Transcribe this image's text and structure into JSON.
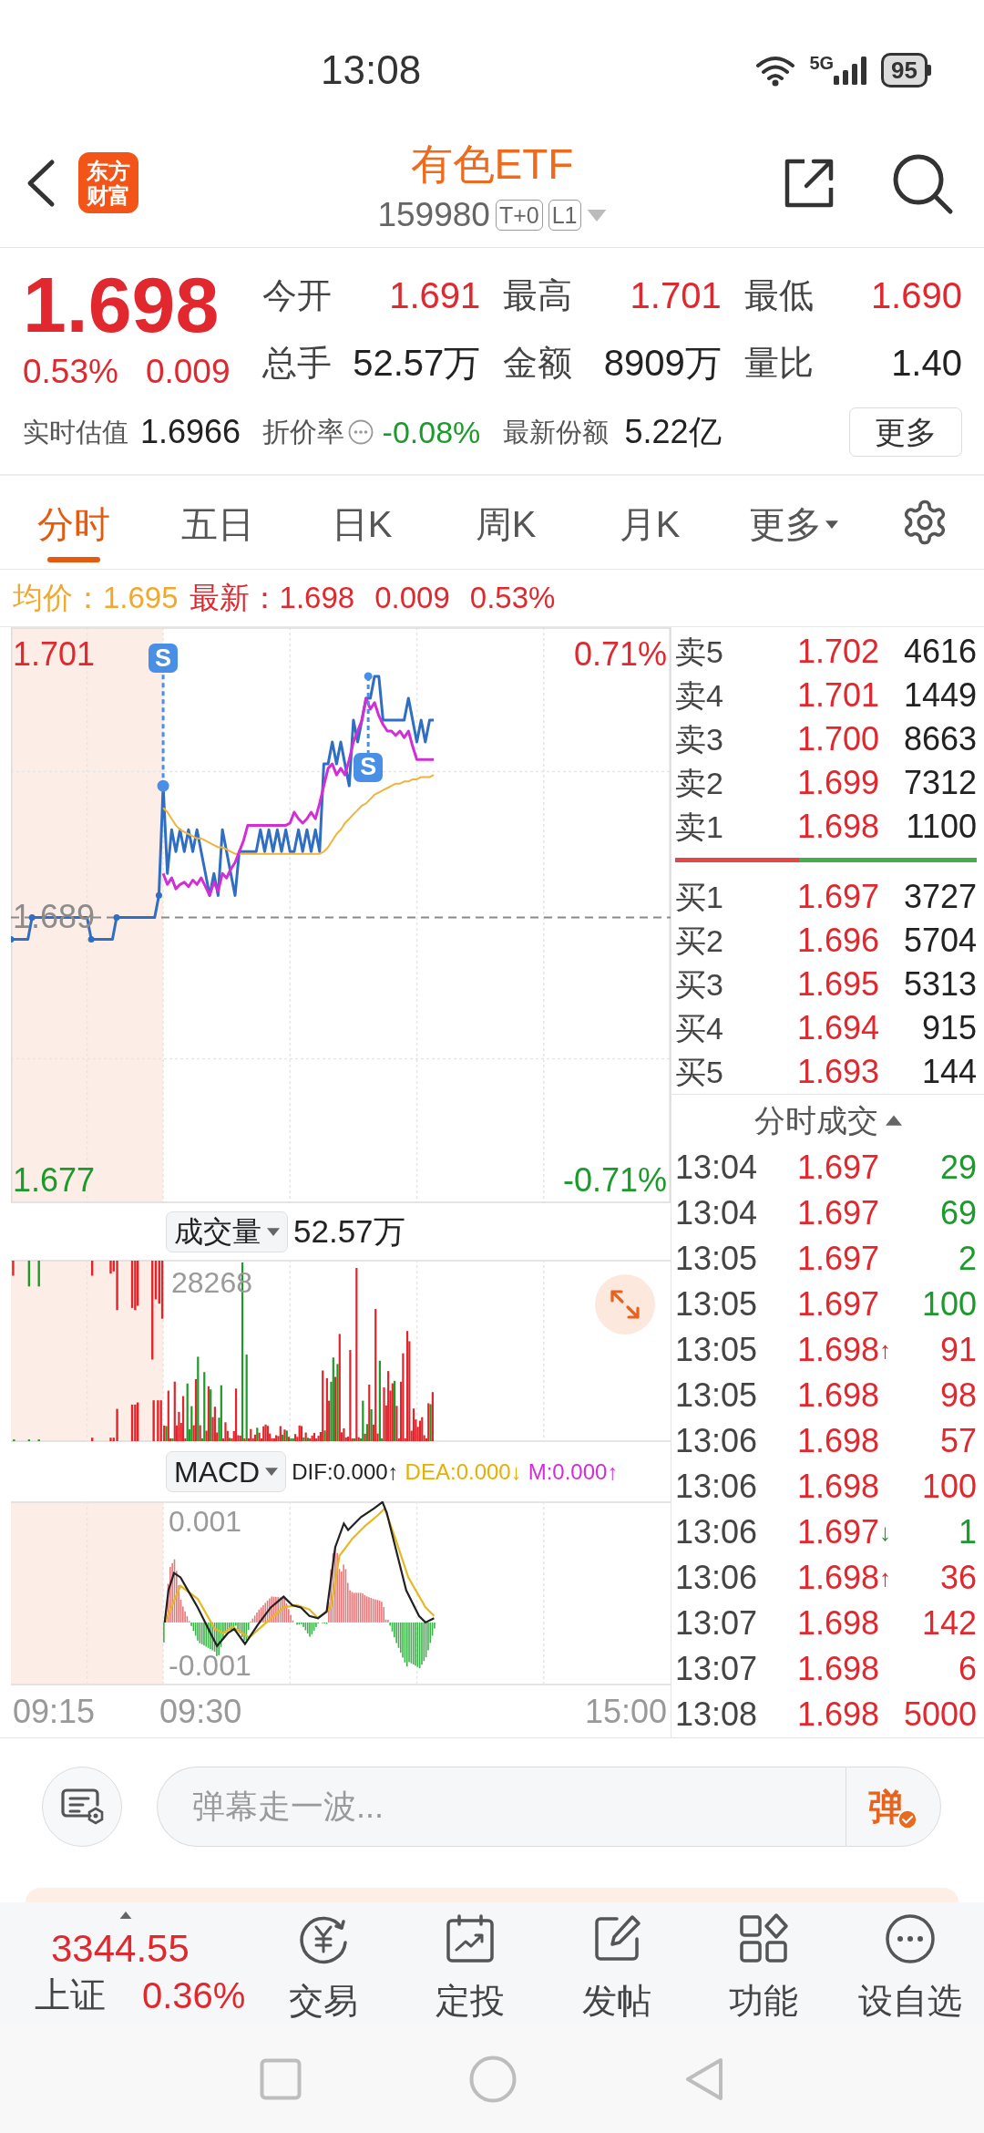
{
  "status_bar": {
    "time": "13:08",
    "network": "5G",
    "battery": "95"
  },
  "header": {
    "logo_lines": [
      "东方",
      "财富"
    ],
    "title": "有色ETF",
    "code": "159980",
    "tags": [
      "T+0",
      "L1"
    ]
  },
  "quote": {
    "price": "1.698",
    "change_percent": "0.53%",
    "change": "0.009",
    "stats": [
      {
        "label": "今开",
        "value": "1.691",
        "color": "#e1282f"
      },
      {
        "label": "最高",
        "value": "1.701",
        "color": "#e1282f"
      },
      {
        "label": "最低",
        "value": "1.690",
        "color": "#e1282f"
      },
      {
        "label": "总手",
        "value": "52.57万",
        "color": "#222222"
      },
      {
        "label": "金额",
        "value": "8909万",
        "color": "#222222"
      },
      {
        "label": "量比",
        "value": "1.40",
        "color": "#222222"
      }
    ],
    "estimate": {
      "label": "实时估值",
      "value": "1.6966"
    },
    "discount": {
      "label": "折价率",
      "value": "-0.08%"
    },
    "shares": {
      "label": "最新份额",
      "value": "5.22亿"
    },
    "more_button": "更多"
  },
  "tabs": [
    {
      "label": "分时",
      "selected": true,
      "kind": "tab"
    },
    {
      "label": "五日",
      "selected": false,
      "kind": "tab"
    },
    {
      "label": "日K",
      "selected": false,
      "kind": "tab"
    },
    {
      "label": "周K",
      "selected": false,
      "kind": "tab"
    },
    {
      "label": "月K",
      "selected": false,
      "kind": "tab"
    },
    {
      "label": "更多",
      "selected": false,
      "kind": "dropdown"
    }
  ],
  "legend": {
    "avg_label": "均价：",
    "avg_value": "1.695",
    "last_label": "最新：",
    "last_value": "1.698",
    "change": "0.009",
    "change_percent": "0.53%"
  },
  "price_chart": {
    "right_labels": [
      "0.71%",
      "-0.71%"
    ],
    "markers": [
      {
        "text": "S"
      },
      {
        "text": "S"
      }
    ],
    "chart_data": {
      "type": "line",
      "categories": [
        null,
        null,
        null,
        null,
        null,
        null,
        null,
        null,
        null,
        null,
        null,
        null,
        null,
        null,
        null,
        null,
        null,
        null,
        null,
        null,
        null,
        null,
        null,
        null,
        null,
        null,
        null,
        null,
        null,
        null,
        null,
        null,
        null,
        null,
        null,
        null,
        null,
        null,
        null,
        null,
        null,
        null,
        null,
        null,
        null,
        null,
        null,
        null,
        null,
        null,
        null,
        null,
        null,
        null,
        null,
        null,
        null,
        null,
        null,
        null,
        null,
        null,
        null,
        null,
        null,
        null,
        null,
        null,
        null,
        null,
        null,
        null,
        null,
        null,
        null,
        null,
        null,
        null,
        null,
        null,
        null,
        null,
        null,
        null,
        null,
        null,
        null,
        null,
        null,
        null,
        null,
        null,
        null,
        null,
        null,
        null,
        null,
        null,
        null,
        null,
        null,
        null,
        null,
        null,
        null,
        null,
        null,
        null,
        null,
        null,
        null,
        null,
        null,
        null,
        null,
        null,
        null,
        null,
        null,
        null,
        null,
        null,
        null,
        null,
        null,
        null,
        null,
        null,
        null,
        null,
        null,
        null,
        null,
        null,
        null,
        null,
        null,
        null,
        null,
        null,
        null,
        null,
        null,
        null,
        null,
        null,
        null,
        null,
        null,
        null,
        null,
        null,
        null,
        null,
        null,
        null,
        null
      ],
      "series": [
        {
          "color": "#2f6ec2",
          "values": [
            1.688,
            1.688,
            1.688,
            1.688,
            1.688,
            1.689,
            1.689,
            1.689,
            1.689,
            1.689,
            1.689,
            1.689,
            1.689,
            1.689,
            1.689,
            1.689,
            1.689,
            1.689,
            1.689,
            1.688,
            1.688,
            1.688,
            1.688,
            1.688,
            1.688,
            1.689,
            1.689,
            1.689,
            1.689,
            1.689,
            1.689,
            1.689,
            1.689,
            1.689,
            1.689,
            1.69,
            1.695,
            1.691,
            1.693,
            1.692,
            1.693,
            1.692,
            1.693,
            1.692,
            1.693,
            1.692,
            1.691,
            1.69,
            1.691,
            1.69,
            1.693,
            1.692,
            1.691,
            1.69,
            1.692,
            1.692,
            1.692,
            1.692,
            1.692,
            1.693,
            1.692,
            1.693,
            1.692,
            1.693,
            1.692,
            1.693,
            1.692,
            1.692,
            1.693,
            1.692,
            1.693,
            1.692,
            1.693,
            1.692,
            1.696,
            1.696,
            1.697,
            1.696,
            1.697,
            1.696,
            1.695,
            1.698,
            1.697,
            1.698,
            1.699,
            1.699,
            1.7,
            1.7,
            1.698,
            1.698,
            1.698,
            1.698,
            1.698,
            1.698,
            1.699,
            1.698,
            1.697,
            1.698,
            1.697,
            1.698,
            1.698,
            null,
            null,
            null,
            null,
            null,
            null,
            null,
            null,
            null,
            null,
            null,
            null,
            null,
            null,
            null,
            null,
            null,
            null,
            null,
            null,
            null,
            null,
            null,
            null,
            null,
            null,
            null,
            null,
            null,
            null,
            null,
            null,
            null,
            null,
            null,
            null,
            null,
            null,
            null,
            null,
            null,
            null,
            null,
            null,
            null,
            null,
            null,
            null,
            null,
            null,
            null,
            null,
            null,
            null,
            null,
            null
          ]
        },
        {
          "color": "#f0b43c",
          "values": [
            null,
            null,
            null,
            null,
            null,
            null,
            null,
            null,
            null,
            null,
            null,
            null,
            null,
            null,
            null,
            null,
            null,
            null,
            null,
            null,
            null,
            null,
            null,
            null,
            null,
            null,
            null,
            null,
            null,
            null,
            null,
            null,
            null,
            null,
            null,
            null,
            1.694,
            1.6938,
            1.6935,
            1.6932,
            1.693,
            1.6929,
            1.6928,
            1.6927,
            1.6926,
            1.6926,
            1.6925,
            1.6924,
            1.6923,
            1.6922,
            1.6922,
            1.6921,
            1.692,
            1.6919,
            1.6919,
            1.6919,
            1.6919,
            1.6919,
            1.6919,
            1.6919,
            1.6919,
            1.6919,
            1.6919,
            1.6919,
            1.6919,
            1.6919,
            1.6919,
            1.6919,
            1.6919,
            1.6919,
            1.6919,
            1.6919,
            1.6919,
            1.6919,
            1.692,
            1.6922,
            1.6925,
            1.6928,
            1.693,
            1.6933,
            1.6935,
            1.6937,
            1.6939,
            1.6941,
            1.6942,
            1.6944,
            1.6946,
            1.6947,
            1.6948,
            1.6949,
            1.695,
            1.6951,
            1.6951,
            1.6952,
            1.6952,
            1.6953,
            1.6953,
            1.6954,
            1.6954,
            1.6954,
            1.6955,
            null,
            null,
            null,
            null,
            null,
            null,
            null,
            null,
            null,
            null,
            null,
            null,
            null,
            null,
            null,
            null,
            null,
            null,
            null,
            null,
            null,
            null,
            null,
            null,
            null,
            null,
            null,
            null,
            null,
            null,
            null,
            null,
            null,
            null,
            null,
            null,
            null,
            null,
            null,
            null,
            null,
            null,
            null,
            null,
            null,
            null,
            null,
            null,
            null,
            null,
            null,
            null,
            null,
            null,
            null,
            null
          ]
        },
        {
          "color": "#d22ed6",
          "values": [
            null,
            null,
            null,
            null,
            null,
            null,
            null,
            null,
            null,
            null,
            null,
            null,
            null,
            null,
            null,
            null,
            null,
            null,
            null,
            null,
            null,
            null,
            null,
            null,
            null,
            null,
            null,
            null,
            null,
            null,
            null,
            null,
            null,
            null,
            null,
            null,
            1.691,
            1.6905,
            1.6908,
            1.6903,
            1.6905,
            1.6906,
            1.6904,
            1.6907,
            1.6905,
            1.6908,
            1.6904,
            1.69,
            1.6906,
            1.6902,
            1.691,
            1.6908,
            1.6912,
            1.6915,
            1.692,
            1.6925,
            1.6932,
            1.6932,
            1.6932,
            1.6932,
            1.6932,
            1.6932,
            1.6932,
            1.6932,
            1.6932,
            1.6932,
            1.6933,
            1.6938,
            1.6935,
            1.6933,
            1.6935,
            1.6938,
            1.6935,
            1.6942,
            1.695,
            1.6958,
            1.696,
            1.6955,
            1.6958,
            1.6955,
            1.6962,
            1.697,
            1.6975,
            1.698,
            1.699,
            1.6985,
            1.6988,
            1.6982,
            1.6978,
            1.6975,
            1.6975,
            1.6973,
            1.6975,
            1.6972,
            1.6975,
            1.6968,
            1.6962,
            1.6962,
            1.6962,
            1.6962,
            1.6962,
            null,
            null,
            null,
            null,
            null,
            null,
            null,
            null,
            null,
            null,
            null,
            null,
            null,
            null,
            null,
            null,
            null,
            null,
            null,
            null,
            null,
            null,
            null,
            null,
            null,
            null,
            null,
            null,
            null,
            null,
            null,
            null,
            null,
            null,
            null,
            null,
            null,
            null,
            null,
            null,
            null,
            null,
            null,
            null,
            null,
            null,
            null,
            null,
            null,
            null,
            null,
            null,
            null,
            null,
            null,
            null
          ]
        }
      ],
      "ylim": [
        1.676,
        1.7022
      ],
      "yticks": [
        {
          "value": 1.701,
          "label": "1.701"
        },
        {
          "value": 1.689,
          "label": "1.689"
        },
        {
          "value": 1.677,
          "label": "1.677"
        }
      ],
      "ref_lines": [
        {
          "axis": "y",
          "value": 1.689
        }
      ]
    }
  },
  "volume": {
    "indicator": "成交量",
    "total": "52.57万",
    "max_label": "28268"
  },
  "macd": {
    "indicator": "MACD",
    "readouts": [
      {
        "text": "DIF:0.000↑",
        "color": "#222222"
      },
      {
        "text": "DEA:0.000↓",
        "color": "#e6b000"
      },
      {
        "text": "M:0.000↑",
        "color": "#d22ed6"
      }
    ],
    "top_label": "0.001",
    "bottom_label": "-0.001"
  },
  "time_axis": [
    "09:15",
    "09:30",
    "15:00"
  ],
  "order_book": {
    "asks": [
      {
        "label": "卖5",
        "price": "1.702",
        "volume": "4616"
      },
      {
        "label": "卖4",
        "price": "1.701",
        "volume": "1449"
      },
      {
        "label": "卖3",
        "price": "1.700",
        "volume": "8663"
      },
      {
        "label": "卖2",
        "price": "1.699",
        "volume": "7312"
      },
      {
        "label": "卖1",
        "price": "1.698",
        "volume": "1100"
      }
    ],
    "ratio_bar": {
      "level": 0.41
    },
    "bids": [
      {
        "label": "买1",
        "price": "1.697",
        "volume": "3727"
      },
      {
        "label": "买2",
        "price": "1.696",
        "volume": "5704"
      },
      {
        "label": "买3",
        "price": "1.695",
        "volume": "5313"
      },
      {
        "label": "买4",
        "price": "1.694",
        "volume": "915"
      },
      {
        "label": "买5",
        "price": "1.693",
        "volume": "144"
      }
    ]
  },
  "trades": {
    "title": "分时成交",
    "rows": [
      {
        "time": "13:04",
        "price": "1.697",
        "volume": "29",
        "color": "#1c9a2c"
      },
      {
        "time": "13:04",
        "price": "1.697",
        "volume": "69",
        "color": "#1c9a2c"
      },
      {
        "time": "13:05",
        "price": "1.697",
        "volume": "2",
        "color": "#1c9a2c"
      },
      {
        "time": "13:05",
        "price": "1.697",
        "volume": "100",
        "color": "#1c9a2c"
      },
      {
        "time": "13:05",
        "price": "1.698",
        "tick": {
          "text": "↑",
          "color": "#e1282f"
        },
        "volume": "91",
        "color": "#e1282f"
      },
      {
        "time": "13:05",
        "price": "1.698",
        "volume": "98",
        "color": "#e1282f"
      },
      {
        "time": "13:06",
        "price": "1.698",
        "volume": "57",
        "color": "#e1282f"
      },
      {
        "time": "13:06",
        "price": "1.698",
        "volume": "100",
        "color": "#e1282f"
      },
      {
        "time": "13:06",
        "price": "1.697",
        "tick": {
          "text": "↓",
          "color": "#1c9a2c"
        },
        "volume": "1",
        "color": "#1c9a2c"
      },
      {
        "time": "13:06",
        "price": "1.698",
        "tick": {
          "text": "↑",
          "color": "#e1282f"
        },
        "volume": "36",
        "color": "#e1282f"
      },
      {
        "time": "13:07",
        "price": "1.698",
        "volume": "142",
        "color": "#e1282f"
      },
      {
        "time": "13:07",
        "price": "1.698",
        "volume": "6",
        "color": "#e1282f"
      },
      {
        "time": "13:08",
        "price": "1.698",
        "volume": "5000",
        "color": "#e1282f"
      }
    ]
  },
  "danmaku": {
    "placeholder": "弹幕走一波...",
    "send": "弹"
  },
  "bottom_nav": {
    "index": {
      "value": "3344.55",
      "name": "上证",
      "change": "0.36%"
    },
    "items": [
      {
        "label": "交易",
        "kind": "trade"
      },
      {
        "label": "定投",
        "kind": "plan"
      },
      {
        "label": "发帖",
        "kind": "post"
      },
      {
        "label": "功能",
        "kind": "tools"
      },
      {
        "label": "设自选",
        "kind": "watch"
      }
    ]
  }
}
